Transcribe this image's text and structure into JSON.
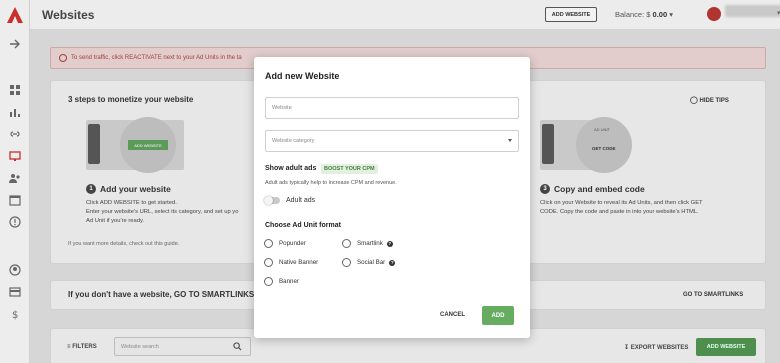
{
  "header": {
    "title": "Websites",
    "add_website": "ADD WEBSITE",
    "balance_label": "Balance:",
    "balance_currency": "$",
    "balance_value": "0.00"
  },
  "alert": {
    "text": "To send traffic, click REACTIVATE next to your Ad Units in the ta"
  },
  "tips": {
    "title": "3 steps to monetize your website",
    "hide_tips": "HIDE TIPS",
    "step1": {
      "number": "1",
      "title": "Add your website",
      "illustration_button": "ADD WEBSITE",
      "lines": [
        "Click ADD WEBSITE to get started.",
        "Enter your website's URL, select its category, and set up yo",
        "Ad Unit if you're ready."
      ]
    },
    "step3": {
      "number": "3",
      "title": "Copy and embed code",
      "illustration_label_top": "AD UNIT",
      "illustration_button": "GET CODE",
      "lines": [
        "Click on your Website to reveal its Ad Units, and then click GET",
        "CODE. Copy the code and paste in into your website's HTML."
      ]
    },
    "details_link": "If you want more details, check out this guide."
  },
  "smartlinks": {
    "text": "If you don't have a website, GO TO SMARTLINKS pa",
    "button": "GO TO SMARTLINKS"
  },
  "toolbar": {
    "filters": "FILTERS",
    "search_placeholder": "Website search",
    "export": "EXPORT WEBSITES",
    "add_website": "ADD WEBSITE"
  },
  "modal": {
    "title": "Add new Website",
    "website_placeholder": "Website",
    "category_placeholder": "Website category",
    "adult_heading": "Show adult ads",
    "adult_badge": "BOOST YOUR CPM",
    "adult_description": "Adult ads typically help to increase CPM and revenue.",
    "adult_toggle_label": "Adult ads",
    "adult_toggle_on": false,
    "format_heading": "Choose Ad Unit format",
    "formats": [
      {
        "label": "Popunder",
        "help": false
      },
      {
        "label": "Smartlink",
        "help": true
      },
      {
        "label": "Native Banner",
        "help": false
      },
      {
        "label": "Social Bar",
        "help": true
      },
      {
        "label": "Banner",
        "help": false
      }
    ],
    "help_symbol": "?",
    "cancel": "CANCEL",
    "add": "ADD"
  },
  "colors": {
    "accent_green": "#66ad62",
    "brand_red": "#b23431",
    "badge_green_bg": "#e3f0e0"
  }
}
